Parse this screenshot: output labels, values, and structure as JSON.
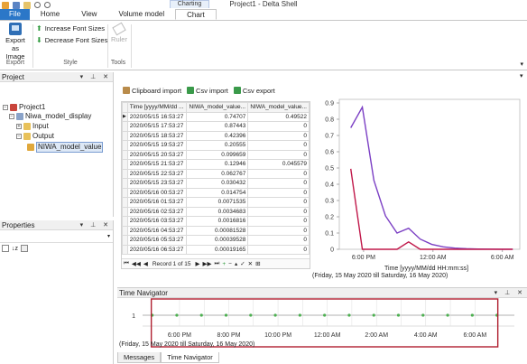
{
  "app": {
    "title": "Project1 - Delta Shell",
    "context_tab": "Charting"
  },
  "ribbon": {
    "tabs": [
      "File",
      "Home",
      "View",
      "Volume model",
      "Chart"
    ],
    "export_label_1": "Export",
    "export_label_2": "as Image",
    "group_export": "Export",
    "increase_font": "Increase Font Sizes",
    "decrease_font": "Decrease Font Sizes",
    "group_style": "Style",
    "ruler": "Ruler",
    "group_tools": "Tools"
  },
  "project_panel": {
    "title": "Project",
    "items": [
      {
        "label": "Project1",
        "icon": "project-icon"
      },
      {
        "label": "Niwa_model_display",
        "icon": "model-icon"
      },
      {
        "label": "Input",
        "icon": "folder-icon"
      },
      {
        "label": "Output",
        "icon": "folder-icon"
      },
      {
        "label": "NIWA_model_value",
        "icon": "timeseries-icon"
      }
    ]
  },
  "properties_panel": {
    "title": "Properties"
  },
  "data_toolbar": {
    "clipboard_import": "Clipboard import",
    "csv_import": "Csv import",
    "csv_export": "Csv export"
  },
  "grid": {
    "columns": [
      "Time [yyyy/MM/dd ...",
      "NIWA_model_value...",
      "NIWA_model_value..."
    ],
    "rows": [
      [
        "2020/05/15 16:53:27",
        "0.74707",
        "0.49522"
      ],
      [
        "2020/05/15 17:53:27",
        "0.87443",
        "0"
      ],
      [
        "2020/05/15 18:53:27",
        "0.42396",
        "0"
      ],
      [
        "2020/05/15 19:53:27",
        "0.20555",
        "0"
      ],
      [
        "2020/05/15 20:53:27",
        "0.099659",
        "0"
      ],
      [
        "2020/05/15 21:53:27",
        "0.12946",
        "0.045579"
      ],
      [
        "2020/05/15 22:53:27",
        "0.062767",
        "0"
      ],
      [
        "2020/05/15 23:53:27",
        "0.030432",
        "0"
      ],
      [
        "2020/05/16 00:53:27",
        "0.014754",
        "0"
      ],
      [
        "2020/05/16 01:53:27",
        "0.0071535",
        "0"
      ],
      [
        "2020/05/16 02:53:27",
        "0.0034683",
        "0"
      ],
      [
        "2020/05/16 03:53:27",
        "0.0016816",
        "0"
      ],
      [
        "2020/05/16 04:53:27",
        "0.00081528",
        "0"
      ],
      [
        "2020/05/16 05:53:27",
        "0.00039528",
        "0"
      ],
      [
        "2020/05/16 06:53:27",
        "0.00019165",
        "0"
      ]
    ],
    "record_text": "Record 1 of 15"
  },
  "chart_data": {
    "type": "line",
    "title": "",
    "xlabel": "Time [yyyy/MM/dd HH:mm:ss]",
    "ylabel": "",
    "ylim": [
      0,
      0.9
    ],
    "yticks": [
      "0",
      "0.1",
      "0.2",
      "0.3",
      "0.4",
      "0.5",
      "0.6",
      "0.7",
      "0.8",
      "0.9"
    ],
    "xticks": [
      "6:00 PM",
      "12:00 AM",
      "6:00 AM"
    ],
    "x": [
      "2020/05/15 16:53:27",
      "2020/05/15 17:53:27",
      "2020/05/15 18:53:27",
      "2020/05/15 19:53:27",
      "2020/05/15 20:53:27",
      "2020/05/15 21:53:27",
      "2020/05/15 22:53:27",
      "2020/05/15 23:53:27",
      "2020/05/16 00:53:27",
      "2020/05/16 01:53:27",
      "2020/05/16 02:53:27",
      "2020/05/16 03:53:27",
      "2020/05/16 04:53:27",
      "2020/05/16 05:53:27",
      "2020/05/16 06:53:27"
    ],
    "series": [
      {
        "color": "#7b3fc4",
        "values": [
          0.74707,
          0.87443,
          0.42396,
          0.20555,
          0.099659,
          0.12946,
          0.062767,
          0.030432,
          0.014754,
          0.0071535,
          0.0034683,
          0.0016816,
          0.00081528,
          0.00039528,
          0.00019165
        ]
      },
      {
        "color": "#c0184a",
        "values": [
          0.49522,
          0,
          0,
          0,
          0,
          0.045579,
          0,
          0,
          0,
          0,
          0,
          0,
          0,
          0,
          0
        ]
      }
    ],
    "range_caption": "(Friday, 15 May 2020 till Saturday, 16 May 2020)"
  },
  "time_navigator": {
    "title": "Time Navigator",
    "row_label": "1",
    "ticks": [
      "6:00 PM",
      "8:00 PM",
      "10:00 PM",
      "12:00 AM",
      "2:00 AM",
      "4:00 AM",
      "6:00 AM"
    ],
    "caption": "(Friday, 15 May 2020 till Saturday, 16 May 2020)",
    "selection_color": "#b02030"
  },
  "bottom_tabs": [
    "Messages",
    "Time Navigator"
  ]
}
